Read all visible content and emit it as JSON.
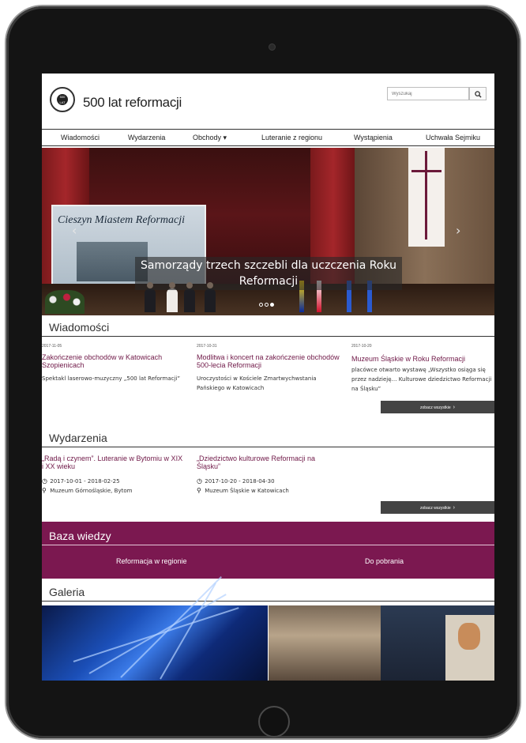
{
  "site": {
    "title": "500 lat reformacji",
    "logo_text": "500 LAT",
    "search_placeholder": "Wyszukaj"
  },
  "nav": {
    "items": [
      {
        "label": "Wiadomości"
      },
      {
        "label": "Wydarzenia"
      },
      {
        "label": "Obchody ▾"
      },
      {
        "label": "Luteranie z regionu"
      },
      {
        "label": "Wystąpienia"
      },
      {
        "label": "Uchwała Sejmiku"
      }
    ]
  },
  "hero": {
    "caption": "Samorządy trzech szczebli dla uczczenia Roku Reformacji",
    "screen_text": "Cieszyn Miastem Reformacji",
    "prev_arrow": "‹",
    "next_arrow": "›",
    "slide_count": 3,
    "active_slide": 3
  },
  "news": {
    "title": "Wiadomości",
    "items": [
      {
        "date": "2017-11-05",
        "title": "Zakończenie obchodów w Katowicach Szopienicach",
        "body": "Spektakl laserowo-muzyczny „500 lat Reformacji”"
      },
      {
        "date": "2017-10-31",
        "title": "Modlitwa i koncert na zakończenie obchodów 500-lecia Reformacji",
        "body": "Uroczystości w Kościele Zmartwychwstania Pańskiego w Katowicach"
      },
      {
        "date": "2017-10-20",
        "title": "Muzeum Śląskie w Roku Reformacji",
        "body": "placówce otwarto wystawę „Wszystko osiąga się przez nadzieję… Kulturowe dziedzictwo Reformacji na Śląsku”"
      }
    ],
    "see_all": "zobacz wszystkie"
  },
  "events": {
    "title": "Wydarzenia",
    "items": [
      {
        "title": "„Radą i czynem”. Luteranie w Bytomiu w XIX i XX wieku",
        "dates": "2017-10-01 - 2018-02-25",
        "place": "Muzeum Górnośląskie, Bytom"
      },
      {
        "title": "„Dziedzictwo kulturowe Reformacji na Śląsku”",
        "dates": "2017-10-20 - 2018-04-30",
        "place": "Muzeum Śląskie w Katowicach"
      }
    ],
    "see_all": "zobacz wszystkie"
  },
  "knowledge": {
    "title": "Baza wiedzy",
    "links": [
      {
        "label": "Reformacja w regionie"
      },
      {
        "label": "Do pobrania"
      }
    ]
  },
  "gallery": {
    "title": "Galeria"
  },
  "colors": {
    "accent": "#7b1850",
    "link": "#6f1847",
    "button": "#444444"
  }
}
